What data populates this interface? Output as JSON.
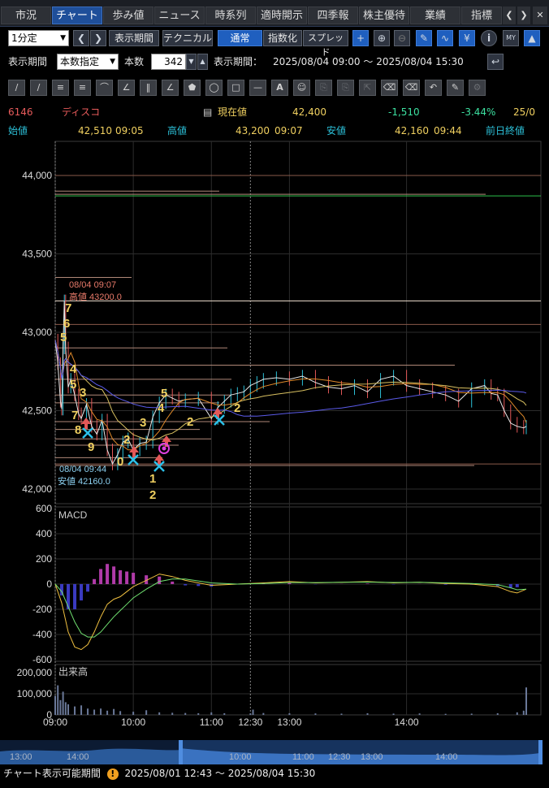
{
  "tabs": [
    {
      "label": "市況"
    },
    {
      "label": "チャート"
    },
    {
      "label": "歩み値"
    },
    {
      "label": "ニュース"
    },
    {
      "label": "時系列"
    },
    {
      "label": "適時開示"
    },
    {
      "label": "四季報"
    },
    {
      "label": "株主優待"
    },
    {
      "label": "業績"
    },
    {
      "label": "指標"
    }
  ],
  "toolbar": {
    "interval": "1分定",
    "period_button": "表示期間",
    "technical_button": "テクニカル",
    "mode_normal": "通常",
    "mode_index": "指数化",
    "mode_spread": "スプレッド",
    "yen_icon": "¥",
    "info_icon": "i",
    "my_icon": "MY"
  },
  "period": {
    "label": "表示期間",
    "mode": "本数指定",
    "count_label": "本数",
    "count": "342",
    "range_label": "表示期間：",
    "range": "2025/08/04 09:00 ～ 2025/08/04 15:30"
  },
  "stock": {
    "code": "6146",
    "name": "ディスコ",
    "current_label": "現在値",
    "current": "42,400",
    "change": "-1,510",
    "change_pct": "-3.44%",
    "date_trunc": "25/0",
    "open_label": "始値",
    "open": "42,510",
    "open_time": "09:05",
    "high_label": "高値",
    "high": "43,200",
    "high_time": "09:07",
    "low_label": "安値",
    "low": "42,160",
    "low_time": "09:44",
    "prev_close_label": "前日終値"
  },
  "colors": {
    "accent": "#1f5fbf",
    "up": "#e35858",
    "down": "#2cc0d8",
    "gold": "#f0d060",
    "negative": "#3ce0a0"
  },
  "chart_data": {
    "type": "line",
    "price": {
      "ylim": [
        42000,
        44000
      ],
      "yticks": [
        "44,000",
        "43,500",
        "43,000",
        "42,500",
        "42,000"
      ],
      "ytick_values": [
        44000,
        43500,
        43000,
        42500,
        42000
      ],
      "xticks": [
        "09:00",
        "10:00",
        "11:00",
        "12:30",
        "13:00",
        "14:00"
      ],
      "xtick_minutes": [
        0,
        60,
        120,
        150,
        180,
        270
      ],
      "x_minutes": [
        0,
        2,
        4,
        5,
        6,
        7,
        8,
        10,
        12,
        15,
        18,
        20,
        24,
        28,
        32,
        36,
        40,
        44,
        48,
        52,
        56,
        60,
        65,
        70,
        75,
        80,
        85,
        90,
        95,
        100,
        110,
        120,
        125,
        130,
        135,
        140,
        145,
        150,
        155,
        160,
        170,
        180,
        190,
        200,
        210,
        220,
        230,
        240,
        250,
        260,
        270,
        280,
        290,
        300,
        310,
        320,
        330,
        335,
        340,
        345,
        350,
        355,
        360,
        362
      ],
      "close": [
        42950,
        42800,
        42560,
        42510,
        42900,
        43200,
        42900,
        42650,
        42700,
        42600,
        42480,
        42450,
        42540,
        42400,
        42350,
        42440,
        42250,
        42160,
        42220,
        42300,
        42320,
        42250,
        42290,
        42300,
        42460,
        42550,
        42600,
        42580,
        42560,
        42570,
        42580,
        42450,
        42520,
        42560,
        42600,
        42610,
        42620,
        42660,
        42680,
        42700,
        42710,
        42700,
        42720,
        42680,
        42650,
        42640,
        42660,
        42620,
        42700,
        42720,
        42660,
        42640,
        42620,
        42600,
        42560,
        42640,
        42660,
        42610,
        42600,
        42500,
        42420,
        42400,
        42390,
        42400
      ],
      "high_annotation": {
        "label": "08/04 09:07",
        "value_label": "高値 43200.0"
      },
      "low_annotation": {
        "label": "08/04 09:44",
        "value_label": "安値 42160.0"
      },
      "counts": [
        "7",
        "6",
        "5",
        "4",
        "5",
        "3",
        "7",
        "8",
        "9",
        "2",
        "0",
        "3",
        "1",
        "2",
        "5",
        "4",
        "2",
        "2"
      ]
    },
    "macd": {
      "title": "MACD",
      "ylim": [
        -600,
        600
      ],
      "yticks": [
        "600",
        "400",
        "200",
        "0",
        "-200",
        "-400",
        "-600"
      ],
      "ytick_values": [
        600,
        400,
        200,
        0,
        -200,
        -400,
        -600
      ],
      "x_minutes": [
        0,
        5,
        10,
        15,
        20,
        25,
        30,
        35,
        40,
        45,
        50,
        55,
        60,
        70,
        80,
        90,
        100,
        110,
        120,
        140,
        160,
        180,
        200,
        220,
        240,
        260,
        280,
        300,
        320,
        340,
        350,
        355,
        362
      ],
      "macd": [
        0,
        -150,
        -380,
        -500,
        -520,
        -480,
        -380,
        -260,
        -160,
        -120,
        -100,
        -60,
        -20,
        30,
        80,
        60,
        30,
        10,
        -10,
        0,
        10,
        20,
        10,
        15,
        20,
        10,
        15,
        5,
        0,
        -20,
        -60,
        -70,
        -40
      ],
      "signal": [
        0,
        -60,
        -180,
        -300,
        -390,
        -420,
        -420,
        -380,
        -320,
        -260,
        -210,
        -160,
        -110,
        -40,
        20,
        40,
        40,
        25,
        10,
        0,
        5,
        12,
        12,
        14,
        16,
        13,
        14,
        10,
        5,
        -5,
        -30,
        -45,
        -40
      ]
    },
    "volume": {
      "title": "出来高",
      "ylim": [
        0,
        200000
      ],
      "yticks": [
        "200,000",
        "100,000",
        "0"
      ],
      "ytick_values": [
        200000,
        100000,
        0
      ],
      "x_minutes": [
        0,
        2,
        4,
        6,
        8,
        10,
        15,
        20,
        25,
        30,
        35,
        40,
        45,
        50,
        60,
        70,
        80,
        90,
        100,
        110,
        120,
        130,
        150,
        152,
        160,
        180,
        200,
        220,
        240,
        260,
        280,
        300,
        320,
        340,
        355,
        360,
        362
      ],
      "values": [
        90000,
        140000,
        70000,
        110000,
        60000,
        50000,
        40000,
        45000,
        30000,
        25000,
        30000,
        20000,
        28000,
        18000,
        15000,
        22000,
        12000,
        10000,
        9000,
        8000,
        12000,
        8000,
        7000,
        25000,
        9000,
        8000,
        7000,
        6000,
        8000,
        6000,
        7000,
        5000,
        6000,
        8000,
        12000,
        20000,
        130000
      ]
    }
  },
  "scroller": {
    "labels": [
      "13:00",
      "14:00",
      "10:00",
      "11:00",
      "12:30",
      "13:00",
      "14:00"
    ]
  },
  "status": {
    "label": "チャート表示可能期間",
    "range": "2025/08/01 12:43 ～ 2025/08/04 15:30"
  }
}
